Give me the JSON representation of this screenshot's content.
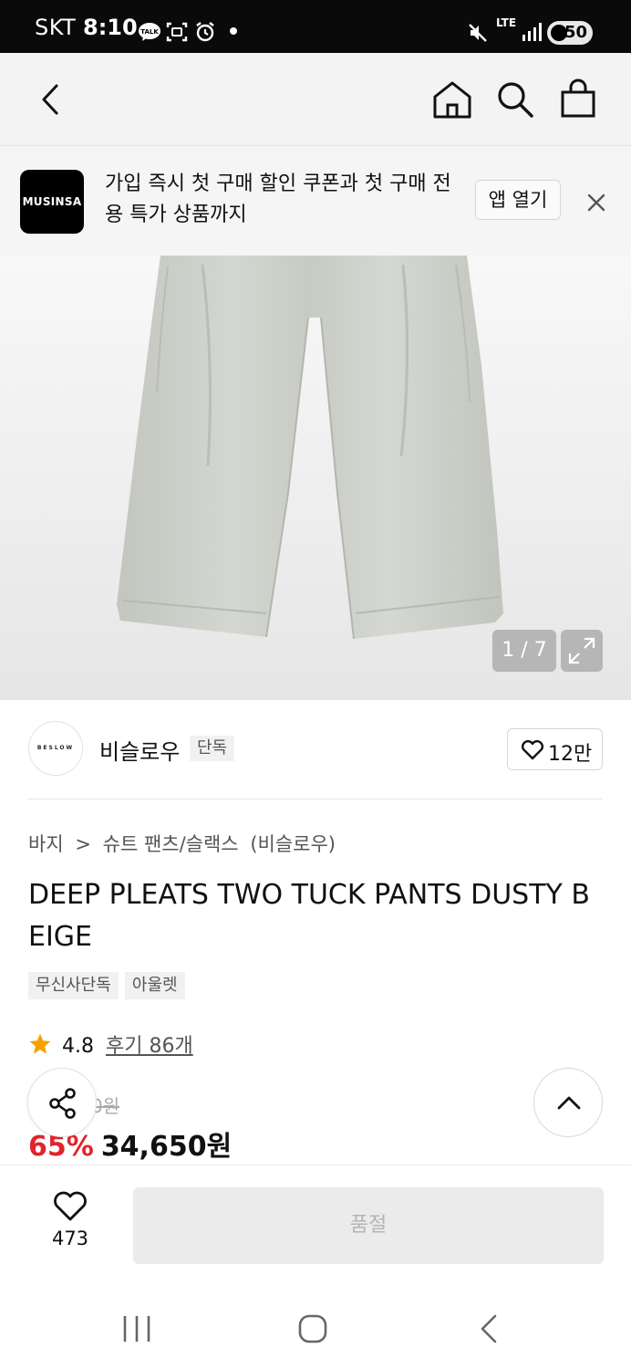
{
  "status_bar": {
    "carrier": "SKT",
    "time": "8:10",
    "network": "LTE",
    "battery": "50"
  },
  "header": {
    "back_icon": "chevron-left-icon",
    "home_icon": "home-icon",
    "search_icon": "search-icon",
    "cart_icon": "shopping-bag-icon"
  },
  "app_banner": {
    "logo_text": "MUSINSA",
    "message": "가입 즉시 첫 구매 할인 쿠폰과 첫 구매 전용 특가 상품까지",
    "open_app_label": "앱 열기",
    "close_icon": "close-icon"
  },
  "gallery": {
    "counter": "1 / 7",
    "expand_icon": "expand-icon"
  },
  "brand": {
    "logo_text": "BESLOW",
    "name": "비슬로우",
    "tag": "단독",
    "likes": "12만"
  },
  "product": {
    "breadcrumb": [
      "바지",
      ">",
      "슈트 팬츠/슬랙스",
      "(비슬로우)"
    ],
    "title": "DEEP PLEATS TWO TUCK PANTS DUSTY BEIGE",
    "tags": [
      "무신사단독",
      "아울렛"
    ],
    "rating": "4.8",
    "reviews_label": "후기 86개",
    "original_price_fragment": "0원",
    "discount": "65%",
    "price": "34,650원"
  },
  "bottom_bar": {
    "wish_count": "473",
    "buy_label": "품절"
  },
  "colors": {
    "discount_red": "#e2242b",
    "rating_star": "#f5a200",
    "soldout_bg": "#ebebeb"
  }
}
